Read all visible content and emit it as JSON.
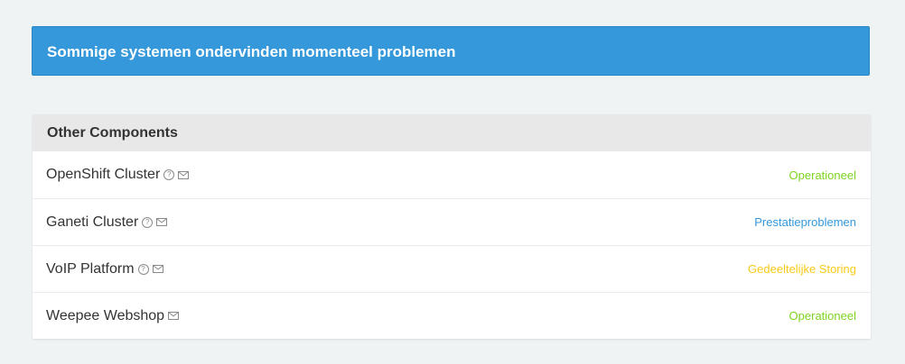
{
  "banner": {
    "text": "Sommige systemen ondervinden momenteel problemen",
    "color": "#3498db"
  },
  "group": {
    "title": "Other Components",
    "components": [
      {
        "name": "OpenShift Cluster",
        "has_help": true,
        "has_subscribe": true,
        "status": "Operationeel",
        "status_color": "#7ed321"
      },
      {
        "name": "Ganeti Cluster",
        "has_help": true,
        "has_subscribe": true,
        "status": "Prestatieproblemen",
        "status_color": "#3498db"
      },
      {
        "name": "VoIP Platform",
        "has_help": true,
        "has_subscribe": true,
        "status": "Gedeeltelijke Storing",
        "status_color": "#f7ca18"
      },
      {
        "name": "Weepee Webshop",
        "has_help": false,
        "has_subscribe": true,
        "status": "Operationeel",
        "status_color": "#7ed321"
      }
    ]
  },
  "icons": {
    "help": "help-circle-icon",
    "subscribe": "envelope-icon",
    "help_glyph": "?"
  }
}
